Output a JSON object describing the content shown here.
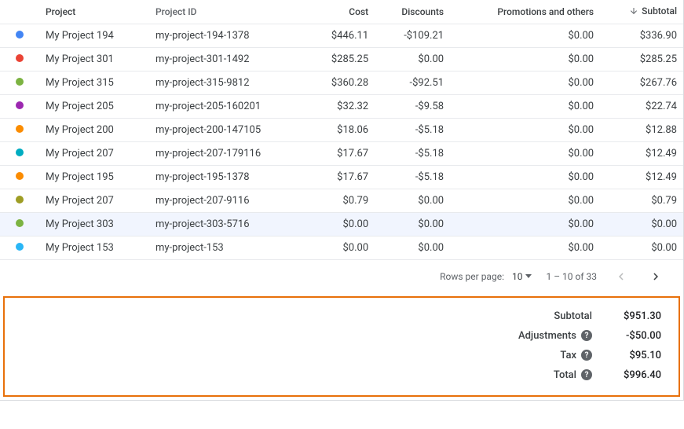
{
  "table": {
    "headers": {
      "project": "Project",
      "project_id": "Project ID",
      "cost": "Cost",
      "discounts": "Discounts",
      "promotions": "Promotions and others",
      "subtotal": "Subtotal"
    },
    "rows": [
      {
        "color": "#4285f4",
        "project": "My Project 194",
        "project_id": "my-project-194-1378",
        "cost": "$446.11",
        "discounts": "-$109.21",
        "promotions": "$0.00",
        "subtotal": "$336.90"
      },
      {
        "color": "#ea4335",
        "project": "My Project 301",
        "project_id": "my-project-301-1492",
        "cost": "$285.25",
        "discounts": "$0.00",
        "promotions": "$0.00",
        "subtotal": "$285.25"
      },
      {
        "color": "#7cb342",
        "project": "My Project 315",
        "project_id": "my-project-315-9812",
        "cost": "$360.28",
        "discounts": "-$92.51",
        "promotions": "$0.00",
        "subtotal": "$267.76"
      },
      {
        "color": "#9c27b0",
        "project": "My Project 205",
        "project_id": "my-project-205-160201",
        "cost": "$32.32",
        "discounts": "-$9.58",
        "promotions": "$0.00",
        "subtotal": "$22.74"
      },
      {
        "color": "#fb8c00",
        "project": "My Project 200",
        "project_id": "my-project-200-147105",
        "cost": "$18.06",
        "discounts": "-$5.18",
        "promotions": "$0.00",
        "subtotal": "$12.88"
      },
      {
        "color": "#00acc1",
        "project": "My Project 207",
        "project_id": "my-project-207-179116",
        "cost": "$17.67",
        "discounts": "-$5.18",
        "promotions": "$0.00",
        "subtotal": "$12.49"
      },
      {
        "color": "#fb8c00",
        "project": "My Project 195",
        "project_id": "my-project-195-1378",
        "cost": "$17.67",
        "discounts": "-$5.18",
        "promotions": "$0.00",
        "subtotal": "$12.49"
      },
      {
        "color": "#9e9d24",
        "project": "My Project 207",
        "project_id": "my-project-207-9116",
        "cost": "$0.79",
        "discounts": "$0.00",
        "promotions": "$0.00",
        "subtotal": "$0.79"
      },
      {
        "color": "#7cb342",
        "project": "My Project 303",
        "project_id": "my-project-303-5716",
        "cost": "$0.00",
        "discounts": "$0.00",
        "promotions": "$0.00",
        "subtotal": "$0.00",
        "hover": true
      },
      {
        "color": "#29b6f6",
        "project": "My Project 153",
        "project_id": "my-project-153",
        "cost": "$0.00",
        "discounts": "$0.00",
        "promotions": "$0.00",
        "subtotal": "$0.00"
      }
    ]
  },
  "pager": {
    "rows_per_page_label": "Rows per page:",
    "rows_per_page_value": "10",
    "range": "1 – 10 of 33"
  },
  "summary": {
    "subtotal_label": "Subtotal",
    "subtotal_value": "$951.30",
    "adjustments_label": "Adjustments",
    "adjustments_value": "-$50.00",
    "tax_label": "Tax",
    "tax_value": "$95.10",
    "total_label": "Total",
    "total_value": "$996.40"
  }
}
